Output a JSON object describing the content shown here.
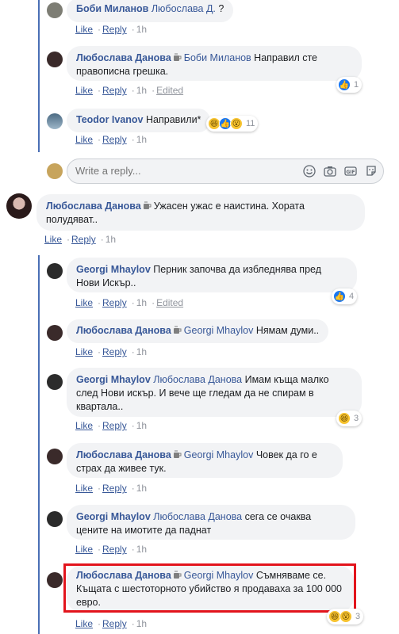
{
  "comments": [
    {
      "author": "Боби Миланов",
      "mention": "Любослава Д.",
      "text": " ?",
      "like": "Like",
      "reply": "Reply",
      "time": "1h"
    },
    {
      "author": "Любослава Данова",
      "mention": "Боби Миланов",
      "text": "Направил сте правописна грешка.",
      "like": "Like",
      "reply": "Reply",
      "time": "1h",
      "edited": "Edited",
      "react_count": "1"
    },
    {
      "author": "Teodor Ivanov",
      "mention": "",
      "text": "Направили*",
      "like": "Like",
      "reply": "Reply",
      "time": "1h",
      "react_count": "11"
    },
    {
      "author": "Любослава Данова",
      "mention": "",
      "text": "Ужасен ужас е наистина. Хората полудяват..",
      "like": "Like",
      "reply": "Reply",
      "time": "1h"
    },
    {
      "author": "Georgi Mhaylov",
      "mention": "",
      "text": "Перник започва да избледнява пред Нови Искър..",
      "like": "Like",
      "reply": "Reply",
      "time": "1h",
      "edited": "Edited",
      "react_count": "4"
    },
    {
      "author": "Любослава Данова",
      "mention": "Georgi Mhaylov",
      "text": "Нямам думи..",
      "like": "Like",
      "reply": "Reply",
      "time": "1h"
    },
    {
      "author": "Georgi Mhaylov",
      "mention": "Любослава Данова",
      "text": "Имам къща малко след Нови искър. И вече ще гледам да не спирам в квартала..",
      "like": "Like",
      "reply": "Reply",
      "time": "1h",
      "react_count": "3"
    },
    {
      "author": "Любослава Данова",
      "mention": "Georgi Mhaylov",
      "text": "Човек да го е страх да живее тук.",
      "like": "Like",
      "reply": "Reply",
      "time": "1h"
    },
    {
      "author": "Georgi Mhaylov",
      "mention": "Любослава Данова",
      "text": "сега се очаква цените на имотите да паднат",
      "like": "Like",
      "reply": "Reply",
      "time": "1h"
    },
    {
      "author": "Любослава Данова",
      "mention": "Georgi Mhaylov",
      "text": "Съмняваме се. Къщата с шестоторното убийство я продаваха за 100 000 евро.",
      "like": "Like",
      "reply": "Reply",
      "time": "1h",
      "react_count": "3"
    }
  ],
  "reply_box": {
    "placeholder": "Write a reply..."
  },
  "colors": {
    "link": "#385898",
    "bubble": "#f2f3f5",
    "highlight": "#e2141c",
    "thread": "#4a6fb5"
  }
}
